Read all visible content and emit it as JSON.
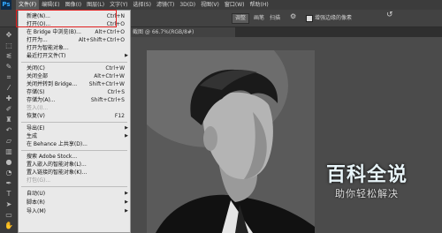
{
  "app": {
    "logo": "Ps"
  },
  "menubar": {
    "items": [
      "文件(F)",
      "编辑(E)",
      "图像(I)",
      "图层(L)",
      "文字(Y)",
      "选择(S)",
      "滤镜(T)",
      "3D(D)",
      "视图(V)",
      "窗口(W)",
      "帮助(H)"
    ]
  },
  "options": {
    "adjust_label": "调整",
    "brush_label": "画笔",
    "scatter_label": "扫描",
    "sample_label": "增强边缘的像素",
    "reset_icon": "reset-icon"
  },
  "tab": {
    "title": "截图 @ 66.7%(RGB/8#)"
  },
  "file_menu": {
    "items": [
      {
        "label": "新建(N)...",
        "shortcut": "Ctrl+N"
      },
      {
        "label": "打开(O)...",
        "shortcut": "Ctrl+O"
      },
      {
        "label": "在 Bridge 中浏览(B)...",
        "shortcut": "Alt+Ctrl+O"
      },
      {
        "label": "打开为...",
        "shortcut": "Alt+Shift+Ctrl+O"
      },
      {
        "label": "打开为智能对象...",
        "shortcut": ""
      },
      {
        "label": "最近打开文件(T)",
        "shortcut": "",
        "submenu": true
      },
      {
        "label": "关闭(C)",
        "shortcut": "Ctrl+W"
      },
      {
        "label": "关闭全部",
        "shortcut": "Alt+Ctrl+W"
      },
      {
        "label": "关闭并转到 Bridge...",
        "shortcut": "Shift+Ctrl+W"
      },
      {
        "label": "存储(S)",
        "shortcut": "Ctrl+S"
      },
      {
        "label": "存储为(A)...",
        "shortcut": "Shift+Ctrl+S"
      },
      {
        "label": "签入(I)...",
        "shortcut": "",
        "disabled": true
      },
      {
        "label": "恢复(V)",
        "shortcut": "F12"
      },
      {
        "label": "导出(E)",
        "shortcut": "",
        "submenu": true
      },
      {
        "label": "生成",
        "shortcut": "",
        "submenu": true
      },
      {
        "label": "在 Behance 上共享(D)...",
        "shortcut": ""
      },
      {
        "label": "搜索 Adobe Stock...",
        "shortcut": ""
      },
      {
        "label": "置入嵌入的智能对象(L)...",
        "shortcut": ""
      },
      {
        "label": "置入链接的智能对象(K)...",
        "shortcut": ""
      },
      {
        "label": "打包(G)...",
        "shortcut": "",
        "disabled": true
      },
      {
        "label": "自动(U)",
        "shortcut": "",
        "submenu": true
      },
      {
        "label": "脚本(R)",
        "shortcut": "",
        "submenu": true
      },
      {
        "label": "导入(M)",
        "shortcut": "",
        "submenu": true
      }
    ]
  },
  "watermark": {
    "title": "百科全说",
    "subtitle": "助你轻松解决"
  }
}
